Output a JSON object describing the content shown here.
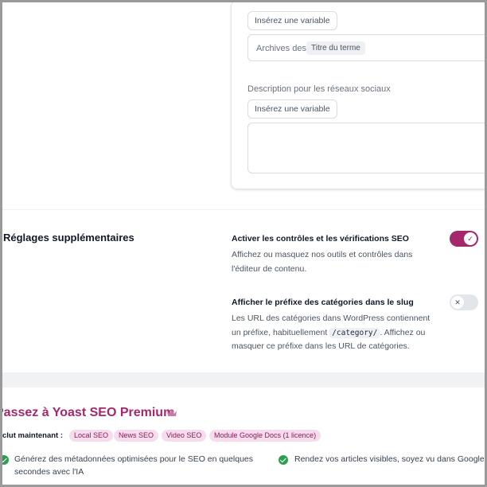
{
  "card": {
    "insert_variable_1": "Insérez une variable",
    "field_prefix": "Archives des",
    "field_variable": "Titre du terme",
    "social_description_label": "Description pour les réseaux sociaux",
    "insert_variable_2": "Insérez une variable"
  },
  "additional_settings": {
    "title": "Réglages supplémentaires",
    "seo_controls": {
      "title": "Activer les contrôles et les vérifications SEO",
      "description": "Affichez ou masquez nos outils et contrôles dans l'éditeur de contenu.",
      "enabled": true
    },
    "category_prefix": {
      "title": "Afficher le préfixe des catégories dans le slug",
      "desc_line1": "Les URL des catégories dans WordPress contiennent",
      "desc_line2_before": "un préfixe, habituellement ",
      "code": "/category/",
      "desc_line2_after": ". Affichez ou",
      "desc_line3": "masquer ce préfixe dans les URL de catégories.",
      "enabled": false
    }
  },
  "premium": {
    "title": "Passez à Yoast SEO Premium",
    "includes_label": "clut maintenant :",
    "tags": [
      "Local SEO",
      "News SEO",
      "Video SEO",
      "Module Google Docs (1 licence)"
    ],
    "feature_1_line1": "Générez des métadonnées optimisées pour le SEO en quelques",
    "feature_1_line2": "secondes avec l'IA",
    "feature_2_line1": "Rendez vos articles visibles, soyez vu dans Google N"
  },
  "colors": {
    "accent": "#a4286a",
    "check": "#2e9e50"
  }
}
